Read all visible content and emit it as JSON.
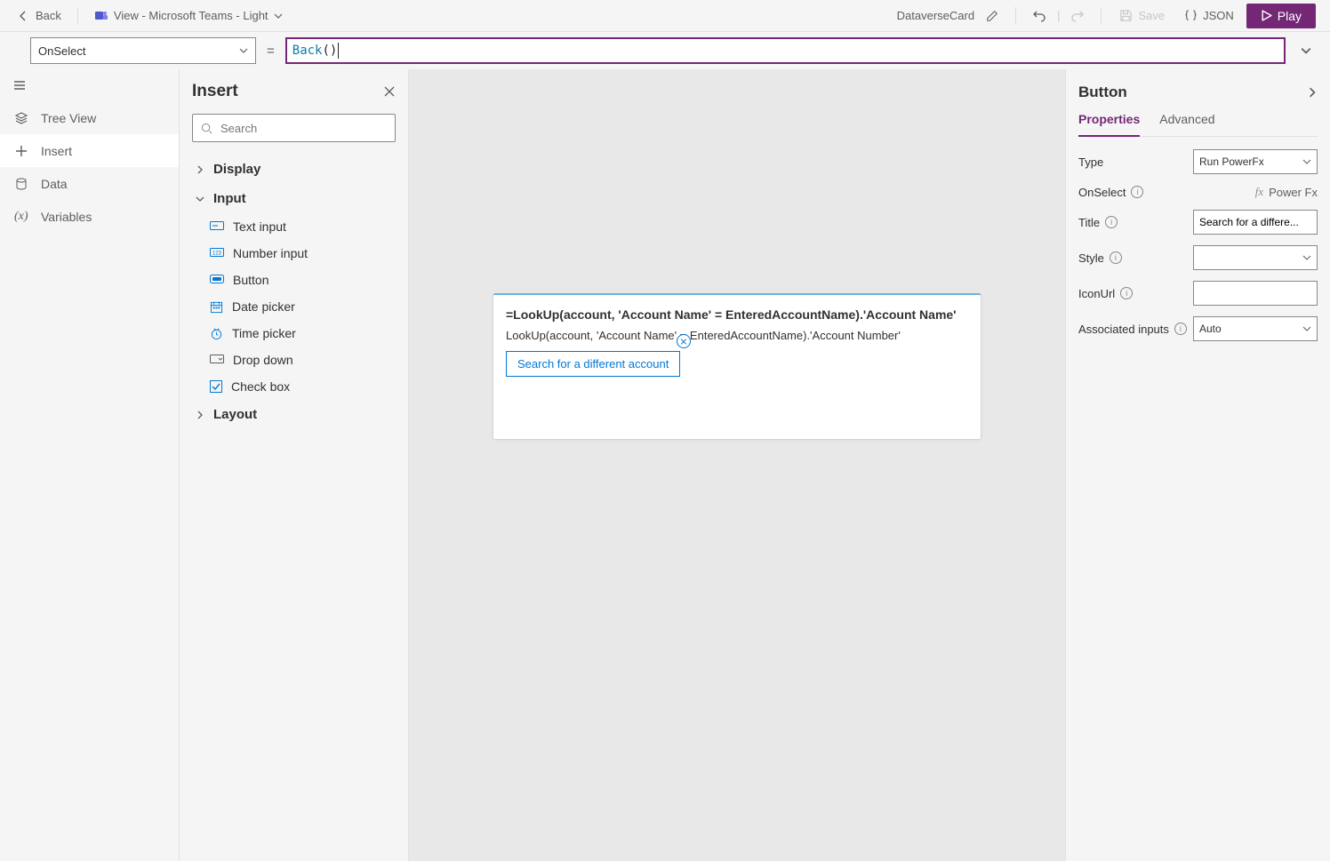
{
  "topbar": {
    "back": "Back",
    "theme": "View - Microsoft Teams - Light",
    "card_name": "DataverseCard",
    "save": "Save",
    "json": "JSON",
    "play": "Play"
  },
  "formula": {
    "property": "OnSelect",
    "fn": "Back",
    "rest": "()"
  },
  "rail": {
    "tree": "Tree View",
    "insert": "Insert",
    "data": "Data",
    "variables": "Variables"
  },
  "insert_panel": {
    "title": "Insert",
    "search_placeholder": "Search",
    "categories": {
      "display": "Display",
      "input": "Input",
      "layout": "Layout"
    },
    "input_items": {
      "text": "Text input",
      "number": "Number input",
      "button": "Button",
      "date": "Date picker",
      "time": "Time picker",
      "dropdown": "Drop down",
      "checkbox": "Check box"
    }
  },
  "card": {
    "title": "=LookUp(account, 'Account Name' = EnteredAccountName).'Account Name'",
    "sub": "LookUp(account, 'Account Name' = EnteredAccountName).'Account Number'",
    "btn": "Search for a different account"
  },
  "props": {
    "heading": "Button",
    "tab_props": "Properties",
    "tab_adv": "Advanced",
    "type_label": "Type",
    "type_value": "Run PowerFx",
    "onselect_label": "OnSelect",
    "onselect_value": "Power Fx",
    "title_label": "Title",
    "title_value": "Search for a differe...",
    "style_label": "Style",
    "style_value": "",
    "iconurl_label": "IconUrl",
    "iconurl_value": "",
    "assoc_label": "Associated inputs",
    "assoc_value": "Auto"
  }
}
